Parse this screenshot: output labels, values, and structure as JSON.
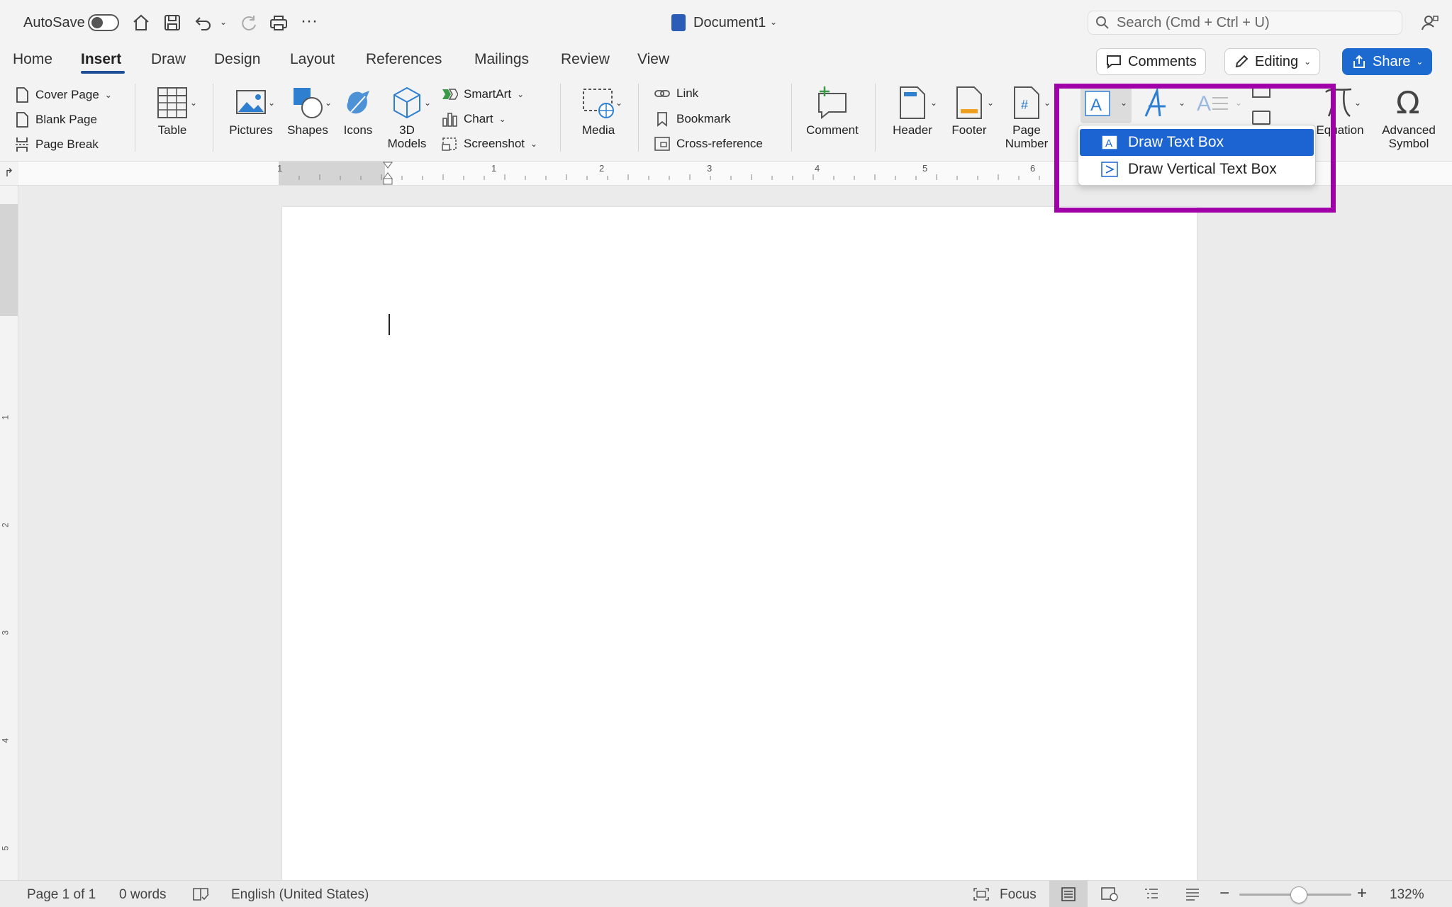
{
  "titlebar": {
    "autosave_label": "AutoSave",
    "document_title": "Document1",
    "search_placeholder": "Search (Cmd + Ctrl + U)"
  },
  "tabs": [
    "Home",
    "Insert",
    "Draw",
    "Design",
    "Layout",
    "References",
    "Mailings",
    "Review",
    "View"
  ],
  "active_tab": "Insert",
  "header_buttons": {
    "comments": "Comments",
    "editing": "Editing",
    "share": "Share"
  },
  "ribbon": {
    "pages": [
      "Cover Page",
      "Blank Page",
      "Page Break"
    ],
    "table": "Table",
    "pictures": "Pictures",
    "shapes": "Shapes",
    "icons": "Icons",
    "models_line1": "3D",
    "models_line2": "Models",
    "smartart": "SmartArt",
    "chart": "Chart",
    "screenshot": "Screenshot",
    "media": "Media",
    "link": "Link",
    "bookmark": "Bookmark",
    "cross_reference": "Cross-reference",
    "comment": "Comment",
    "header": "Header",
    "footer": "Footer",
    "page_number_line1": "Page",
    "page_number_line2": "Number",
    "equation": "Equation",
    "advanced_symbol_line1": "Advanced",
    "advanced_symbol_line2": "Symbol"
  },
  "ruler": {
    "marks": [
      "1",
      "1",
      "2",
      "3",
      "4",
      "5",
      "6"
    ],
    "vmarks": [
      "1",
      "2",
      "3",
      "4",
      "5"
    ]
  },
  "dropdown": {
    "items": [
      "Draw Text Box",
      "Draw Vertical Text Box"
    ],
    "selected_index": 0
  },
  "statusbar": {
    "page": "Page 1 of 1",
    "words": "0 words",
    "language": "English (United States)",
    "focus": "Focus",
    "zoom": "132%"
  },
  "colors": {
    "accent": "#1e4f96",
    "share": "#1c6ad0",
    "highlight": "#a000a8",
    "selection": "#1c64d1"
  }
}
